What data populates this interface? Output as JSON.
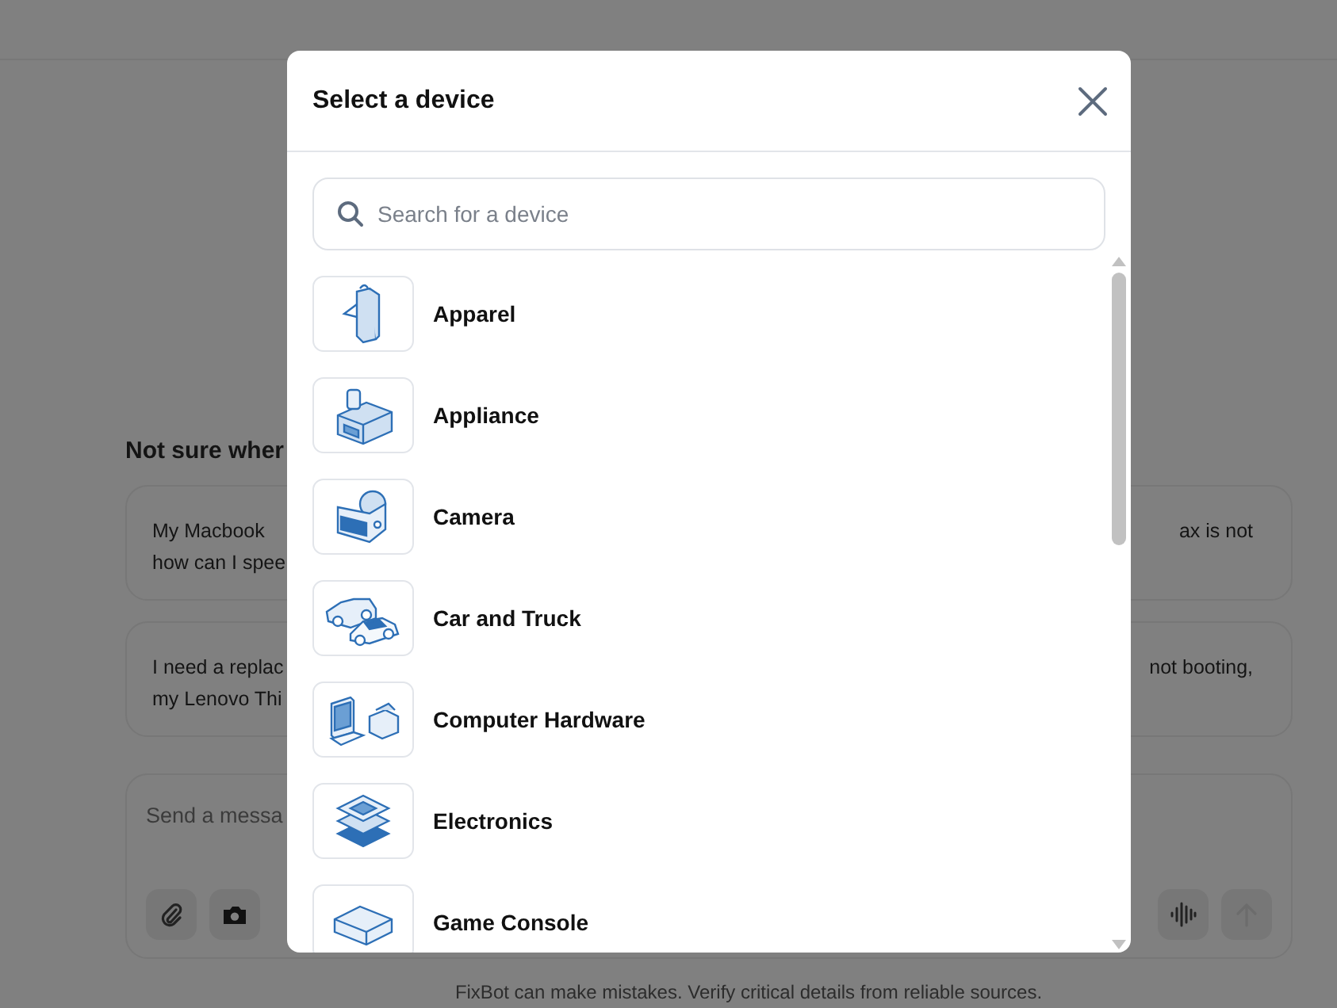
{
  "page": {
    "heading": "Not sure wher",
    "suggestions": [
      {
        "left_lines": [
          "My Macbook",
          "how can I spee"
        ],
        "right_lines": [
          "ax is not"
        ]
      },
      {
        "left_lines": [
          "I need a replac",
          "my Lenovo Thi"
        ],
        "right_lines": [
          "not booting,"
        ]
      }
    ],
    "composer": {
      "placeholder": "Send a messa"
    },
    "disclaimer": "FixBot can make mistakes. Verify critical details from reliable sources."
  },
  "modal": {
    "title": "Select a device",
    "search": {
      "placeholder": "Search for a device"
    },
    "devices": [
      {
        "label": "Apparel",
        "kind": "apparel"
      },
      {
        "label": "Appliance",
        "kind": "appliance"
      },
      {
        "label": "Camera",
        "kind": "camera"
      },
      {
        "label": "Car and Truck",
        "kind": "car"
      },
      {
        "label": "Computer Hardware",
        "kind": "computer"
      },
      {
        "label": "Electronics",
        "kind": "electronics"
      },
      {
        "label": "Game Console",
        "kind": "console"
      }
    ]
  }
}
